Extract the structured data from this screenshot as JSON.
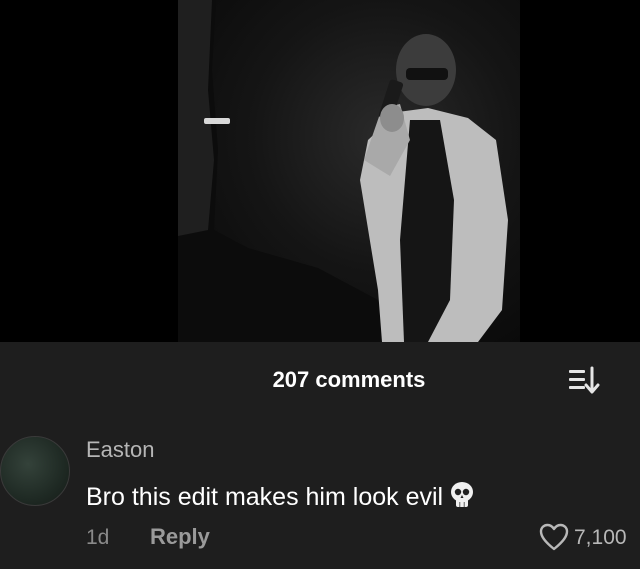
{
  "comments_header": {
    "count_label": "207 comments",
    "sort_icon": "sort-list-icon"
  },
  "comment": {
    "username": "Easton",
    "text": "Bro this edit makes him look evil",
    "emoji_icon": "skull-emoji-icon",
    "time_ago": "1d",
    "reply_label": "Reply",
    "like_icon": "heart-outline-icon",
    "like_count": "7,100"
  },
  "colors": {
    "sheet_background": "#1e1e1e",
    "video_background": "#000000"
  }
}
